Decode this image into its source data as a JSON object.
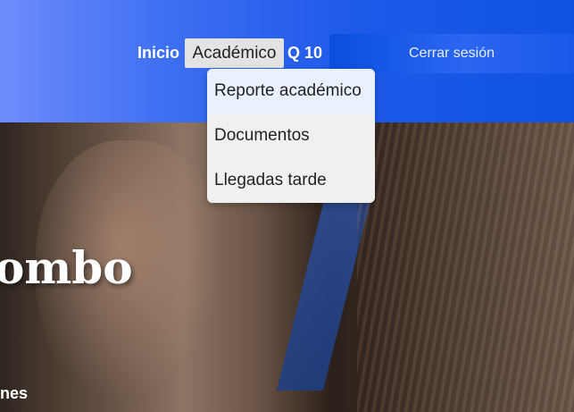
{
  "nav": {
    "home_label": "Inicio",
    "academic_label": "Académico",
    "q10_label": "Q 10",
    "logout_label": "Cerrar sesión"
  },
  "dropdown": {
    "items": [
      {
        "label": "Reporte académico"
      },
      {
        "label": "Documentos"
      },
      {
        "label": "Llegadas tarde"
      }
    ]
  },
  "hero": {
    "title_fragment": "ombo",
    "subtitle_fragment": "nes"
  },
  "colors": {
    "header_gradient_start": "#6f8cfb",
    "header_gradient_end": "#0f52e2",
    "active_nav_bg": "#e3e3e3",
    "dropdown_bg": "#f0f0f0",
    "dropdown_hover_bg": "#e9f1ff"
  }
}
